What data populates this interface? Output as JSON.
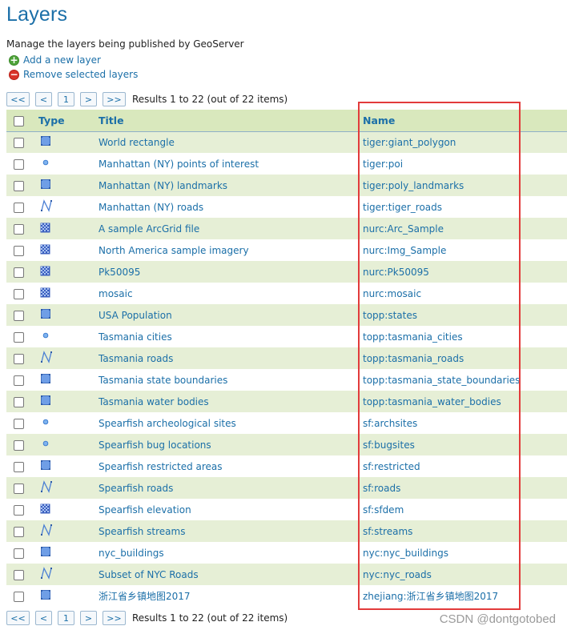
{
  "page": {
    "title": "Layers",
    "description": "Manage the layers being published by GeoServer"
  },
  "actions": {
    "add": "Add a new layer",
    "remove": "Remove selected layers"
  },
  "pager": {
    "first": "<<",
    "prev": "<",
    "page": "1",
    "next": ">",
    "last": ">>",
    "results": "Results 1 to 22 (out of 22 items)"
  },
  "table": {
    "headers": {
      "type": "Type",
      "title": "Title",
      "name": "Name"
    },
    "rows": [
      {
        "type": "polygon",
        "title": "World rectangle",
        "name": "tiger:giant_polygon"
      },
      {
        "type": "point",
        "title": "Manhattan (NY) points of interest",
        "name": "tiger:poi"
      },
      {
        "type": "polygon",
        "title": "Manhattan (NY) landmarks",
        "name": "tiger:poly_landmarks"
      },
      {
        "type": "line",
        "title": "Manhattan (NY) roads",
        "name": "tiger:tiger_roads"
      },
      {
        "type": "raster",
        "title": "A sample ArcGrid file",
        "name": "nurc:Arc_Sample"
      },
      {
        "type": "raster",
        "title": "North America sample imagery",
        "name": "nurc:Img_Sample"
      },
      {
        "type": "raster",
        "title": "Pk50095",
        "name": "nurc:Pk50095"
      },
      {
        "type": "raster",
        "title": "mosaic",
        "name": "nurc:mosaic"
      },
      {
        "type": "polygon",
        "title": "USA Population",
        "name": "topp:states"
      },
      {
        "type": "point",
        "title": "Tasmania cities",
        "name": "topp:tasmania_cities"
      },
      {
        "type": "line",
        "title": "Tasmania roads",
        "name": "topp:tasmania_roads"
      },
      {
        "type": "polygon",
        "title": "Tasmania state boundaries",
        "name": "topp:tasmania_state_boundaries"
      },
      {
        "type": "polygon",
        "title": "Tasmania water bodies",
        "name": "topp:tasmania_water_bodies"
      },
      {
        "type": "point",
        "title": "Spearfish archeological sites",
        "name": "sf:archsites"
      },
      {
        "type": "point",
        "title": "Spearfish bug locations",
        "name": "sf:bugsites"
      },
      {
        "type": "polygon",
        "title": "Spearfish restricted areas",
        "name": "sf:restricted"
      },
      {
        "type": "line",
        "title": "Spearfish roads",
        "name": "sf:roads"
      },
      {
        "type": "raster",
        "title": "Spearfish elevation",
        "name": "sf:sfdem"
      },
      {
        "type": "line",
        "title": "Spearfish streams",
        "name": "sf:streams"
      },
      {
        "type": "polygon",
        "title": "nyc_buildings",
        "name": "nyc:nyc_buildings"
      },
      {
        "type": "line",
        "title": "Subset of NYC Roads",
        "name": "nyc:nyc_roads"
      },
      {
        "type": "polygon",
        "title": "浙江省乡镇地图2017",
        "name": "zhejiang:浙江省乡镇地图2017"
      }
    ]
  },
  "watermark": "CSDN @dontgotobed",
  "colors": {
    "link": "#1b6fa8",
    "header_bg": "#d9e8bd",
    "alt_row_bg": "#e6efd6",
    "highlight": "#e23b3b"
  }
}
